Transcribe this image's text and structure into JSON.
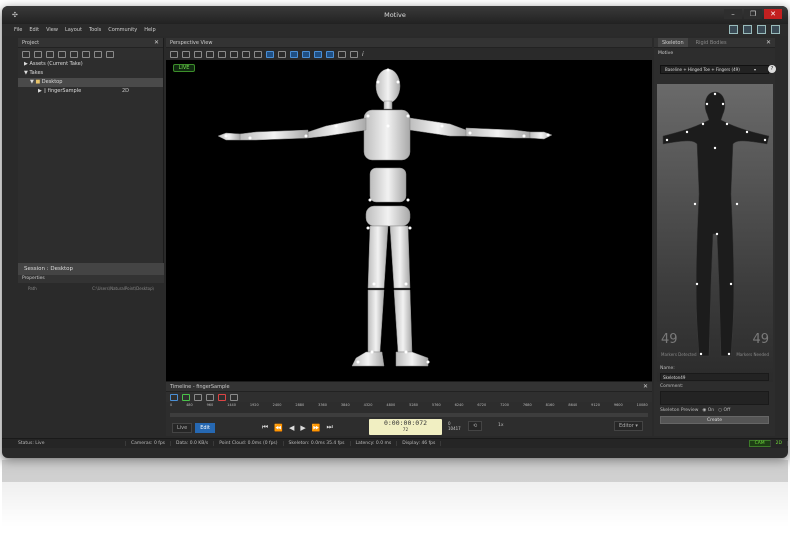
{
  "app": {
    "title": "Motive"
  },
  "menu": [
    "File",
    "Edit",
    "View",
    "Layout",
    "Tools",
    "Community",
    "Help"
  ],
  "project": {
    "header": "Project",
    "assets_label": "Assets (Current Take)",
    "takes_label": "Takes",
    "desktop_label": "Desktop",
    "take_name": "fingerSample",
    "take_badge": "2D"
  },
  "session": {
    "header": "Session : Desktop",
    "props_tab": "Properties",
    "path_label": "Path",
    "path_value": "C:\\Users\\NaturalPoint\\Desktop\\"
  },
  "viewport": {
    "header": "Perspective View",
    "live_badge": "LIVE"
  },
  "timeline": {
    "header": "Timeline - fingerSample",
    "ticks": [
      "0",
      "480",
      "960",
      "1440",
      "1920",
      "2400",
      "2880",
      "3360",
      "3840",
      "4320",
      "4800",
      "5280",
      "5760",
      "6240",
      "6720",
      "7200",
      "7680",
      "8160",
      "8640",
      "9120",
      "9600",
      "10080"
    ],
    "live_btn": "Live",
    "edit_btn": "Edit",
    "timecode": "0:00:00:072",
    "frame": "72",
    "frame_a": "0",
    "frame_b": "10417",
    "speed": "1x",
    "editor": "Editor"
  },
  "right_panel": {
    "tab_skeleton": "Skeleton",
    "tab_rigid": "Rigid Bodies",
    "motive_label": "Motive",
    "preset": "Baseline + Hinged Toe + Fingers (49)",
    "markers_detected_num": "49",
    "markers_detected_lbl": "Markers Detected",
    "markers_needed_num": "49",
    "markers_needed_lbl": "Markers Needed",
    "name_label": "Name:",
    "name_value": "Skeleton49",
    "comment_label": "Comment:",
    "preview_label": "Skeleton Preview",
    "on_label": "On",
    "off_label": "Off",
    "create_label": "Create"
  },
  "status": {
    "status": "Status: Live",
    "cameras": "Cameras: 0 fps",
    "data": "Data: 0.0 KB/s",
    "pointcloud": "Point Cloud: 0.0ms (0 fps)",
    "skeleton": "Skeleton: 0.0ms 35.4 fps",
    "latency": "Latency: 0.0 ms",
    "display": "Display: 46 fps",
    "cam": "CAM",
    "twod": "2D"
  }
}
